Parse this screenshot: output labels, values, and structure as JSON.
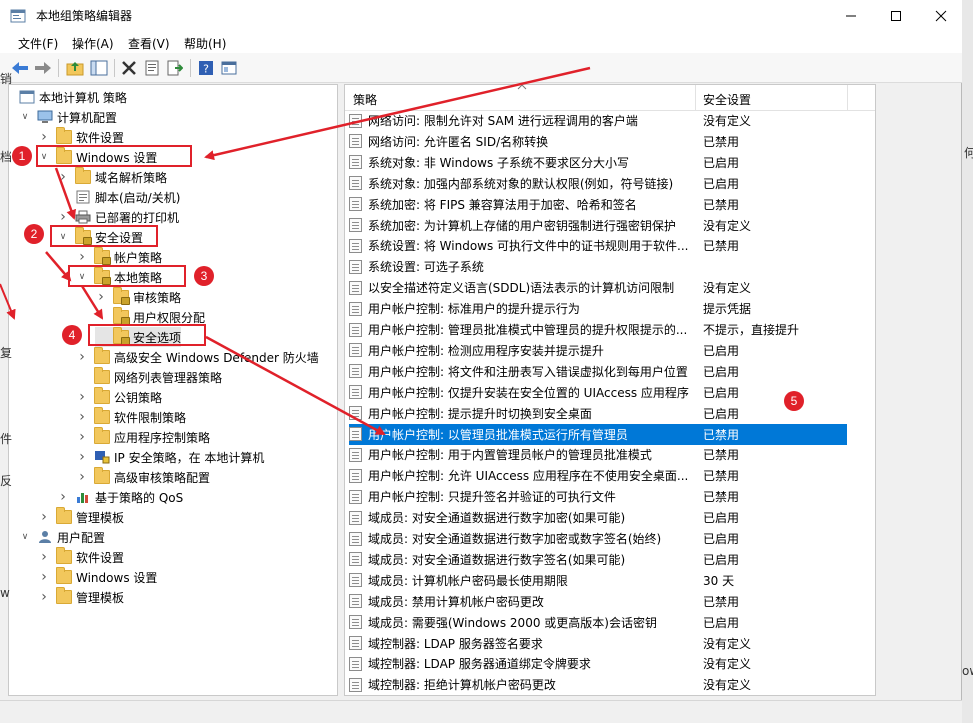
{
  "window": {
    "title": "本地组策略编辑器"
  },
  "menu": [
    "文件(F)",
    "操作(A)",
    "查看(V)",
    "帮助(H)"
  ],
  "tree": [
    {
      "label": "本地计算机 策略"
    },
    {
      "label": "计算机配置"
    },
    {
      "label": "软件设置"
    },
    {
      "label": "Windows 设置"
    },
    {
      "label": "域名解析策略"
    },
    {
      "label": "脚本(启动/关机)"
    },
    {
      "label": "已部署的打印机"
    },
    {
      "label": "安全设置"
    },
    {
      "label": "帐户策略"
    },
    {
      "label": "本地策略"
    },
    {
      "label": "审核策略"
    },
    {
      "label": "用户权限分配"
    },
    {
      "label": "安全选项"
    },
    {
      "label": "高级安全 Windows Defender 防火墙"
    },
    {
      "label": "网络列表管理器策略"
    },
    {
      "label": "公钥策略"
    },
    {
      "label": "软件限制策略"
    },
    {
      "label": "应用程序控制策略"
    },
    {
      "label": "IP 安全策略，在 本地计算机"
    },
    {
      "label": "高级审核策略配置"
    },
    {
      "label": "基于策略的 QoS"
    },
    {
      "label": "管理模板"
    },
    {
      "label": "用户配置"
    },
    {
      "label": "软件设置"
    },
    {
      "label": "Windows 设置"
    },
    {
      "label": "管理模板"
    }
  ],
  "list": {
    "col_policy": "策略",
    "col_setting": "安全设置",
    "rows": [
      {
        "name": "网络访问: 限制允许对 SAM 进行远程调用的客户端",
        "state": "没有定义"
      },
      {
        "name": "网络访问: 允许匿名 SID/名称转换",
        "state": "已禁用"
      },
      {
        "name": "系统对象: 非 Windows 子系统不要求区分大小写",
        "state": "已启用"
      },
      {
        "name": "系统对象: 加强内部系统对象的默认权限(例如，符号链接)",
        "state": "已启用"
      },
      {
        "name": "系统加密: 将 FIPS 兼容算法用于加密、哈希和签名",
        "state": "已禁用"
      },
      {
        "name": "系统加密: 为计算机上存储的用户密钥强制进行强密钥保护",
        "state": "没有定义"
      },
      {
        "name": "系统设置: 将 Windows 可执行文件中的证书规则用于软件...",
        "state": "已禁用"
      },
      {
        "name": "系统设置: 可选子系统",
        "state": ""
      },
      {
        "name": "以安全描述符定义语言(SDDL)语法表示的计算机访问限制",
        "state": "没有定义"
      },
      {
        "name": "用户帐户控制: 标准用户的提升提示行为",
        "state": "提示凭据"
      },
      {
        "name": "用户帐户控制: 管理员批准模式中管理员的提升权限提示的...",
        "state": "不提示，直接提升"
      },
      {
        "name": "用户帐户控制: 检测应用程序安装并提示提升",
        "state": "已启用"
      },
      {
        "name": "用户帐户控制: 将文件和注册表写入错误虚拟化到每用户位置",
        "state": "已启用"
      },
      {
        "name": "用户帐户控制: 仅提升安装在安全位置的 UIAccess 应用程序",
        "state": "已启用"
      },
      {
        "name": "用户帐户控制: 提示提升时切换到安全桌面",
        "state": "已启用"
      },
      {
        "name": "用户帐户控制: 以管理员批准模式运行所有管理员",
        "state": "已禁用"
      },
      {
        "name": "用户帐户控制: 用于内置管理员帐户的管理员批准模式",
        "state": "已禁用"
      },
      {
        "name": "用户帐户控制: 允许 UIAccess 应用程序在不使用安全桌面...",
        "state": "已禁用"
      },
      {
        "name": "用户帐户控制: 只提升签名并验证的可执行文件",
        "state": "已禁用"
      },
      {
        "name": "域成员: 对安全通道数据进行数字加密(如果可能)",
        "state": "已启用"
      },
      {
        "name": "域成员: 对安全通道数据进行数字加密或数字签名(始终)",
        "state": "已启用"
      },
      {
        "name": "域成员: 对安全通道数据进行数字签名(如果可能)",
        "state": "已启用"
      },
      {
        "name": "域成员: 计算机帐户密码最长使用期限",
        "state": "30 天"
      },
      {
        "name": "域成员: 禁用计算机帐户密码更改",
        "state": "已禁用"
      },
      {
        "name": "域成员: 需要强(Windows 2000 或更高版本)会话密钥",
        "state": "已启用"
      },
      {
        "name": "域控制器: LDAP 服务器签名要求",
        "state": "没有定义"
      },
      {
        "name": "域控制器: LDAP 服务器通道绑定令牌要求",
        "state": "没有定义"
      },
      {
        "name": "域控制器: 拒绝计算机帐户密码更改",
        "state": "没有定义"
      }
    ]
  },
  "annotations": [
    "1",
    "2",
    "3",
    "4",
    "5"
  ],
  "edge_fragments": [
    "销",
    "档",
    "何",
    "复",
    "件",
    "反",
    "w",
    "ow"
  ],
  "colors": {
    "annotation": "#e0212a",
    "selection": "#0078d7"
  }
}
